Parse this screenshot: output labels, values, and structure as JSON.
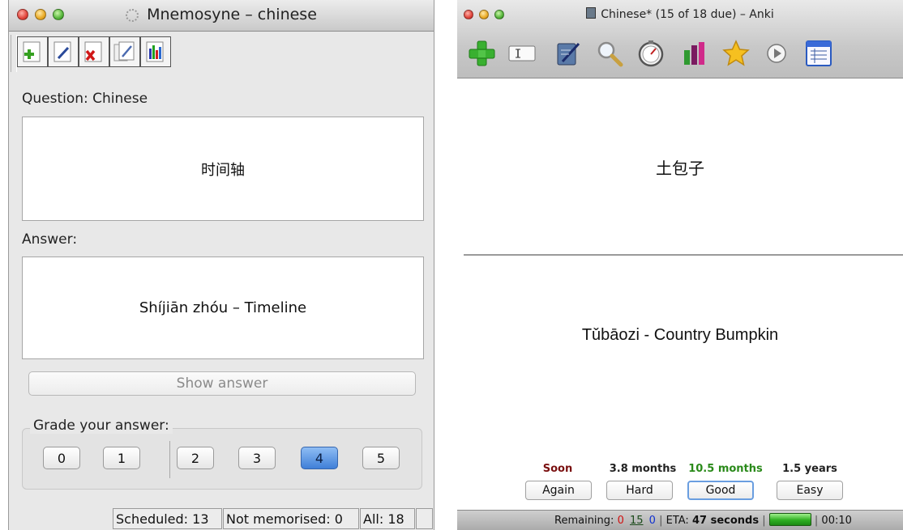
{
  "mnemosyne": {
    "window_title": "Mnemosyne – chinese",
    "toolbar": {
      "add_icon": "add-cards-icon",
      "edit_icon": "edit-card-icon",
      "delete_icon": "delete-card-icon",
      "deck_icon": "edit-deck-icon",
      "stats_icon": "statistics-icon"
    },
    "question_label": "Question: Chinese",
    "question_text": "时间轴",
    "answer_label": "Answer:",
    "answer_text": "Shíjiān zhóu – Timeline",
    "show_answer_label": "Show answer",
    "grade_title": "Grade your answer:",
    "grades": [
      "0",
      "1",
      "2",
      "3",
      "4",
      "5"
    ],
    "selected_grade": "4",
    "status": {
      "scheduled": "Scheduled: 13",
      "not_memorised": "Not memorised: 0",
      "all": "All: 18"
    }
  },
  "anki": {
    "window_title": "Chinese* (15 of 18 due) – Anki",
    "toolbar_icons": [
      "add-icon",
      "card-layout-icon",
      "edit-icon",
      "search-icon",
      "timer-icon",
      "graphs-icon",
      "mark-star-icon",
      "play-icon",
      "browse-list-icon"
    ],
    "question_text": "土包子",
    "answer_text": "Tǔbāozi - Country Bumpkin",
    "intervals": [
      {
        "label": "Soon",
        "color": "#7a1010"
      },
      {
        "label": "3.8 months",
        "color": "#222222"
      },
      {
        "label": "10.5 months",
        "color": "#2a8a1a"
      },
      {
        "label": "1.5 years",
        "color": "#222222"
      }
    ],
    "buttons": [
      "Again",
      "Hard",
      "Good",
      "Easy"
    ],
    "status": {
      "remaining_label": "Remaining:",
      "new_count": "0",
      "review_count": "15",
      "learn_count": "0",
      "eta_label": "ETA:",
      "eta_value": "47 seconds",
      "timer": "00:10"
    },
    "colors": {
      "new": "#d01010",
      "review": "#1a4a1a",
      "learn": "#1030d0"
    }
  }
}
